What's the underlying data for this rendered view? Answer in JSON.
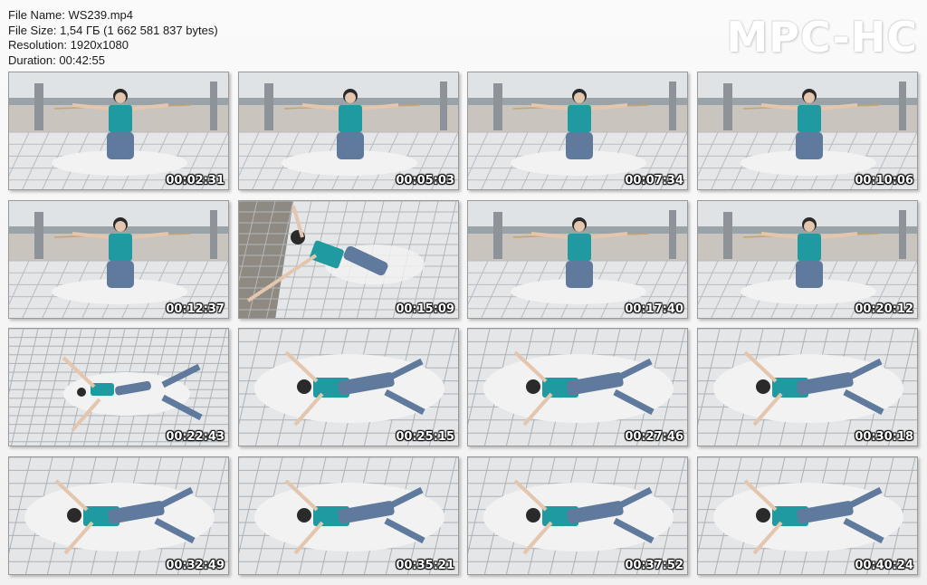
{
  "file_info": {
    "name_line": "File Name: WS239.mp4",
    "size_line": "File Size: 1,54 ГБ (1 662 581 837 bytes)",
    "resolution_line": "Resolution: 1920x1080",
    "duration_line": "Duration: 00:42:55"
  },
  "logo": "MPC-HC",
  "thumbnails": [
    {
      "time": "00:02:31",
      "scene": "kneel-roof"
    },
    {
      "time": "00:05:03",
      "scene": "kneel-roof"
    },
    {
      "time": "00:07:34",
      "scene": "kneel-roof"
    },
    {
      "time": "00:10:06",
      "scene": "kneel-roof"
    },
    {
      "time": "00:12:37",
      "scene": "kneel-roof"
    },
    {
      "time": "00:15:09",
      "scene": "tilted"
    },
    {
      "time": "00:17:40",
      "scene": "kneel-roof"
    },
    {
      "time": "00:20:12",
      "scene": "kneel-roof"
    },
    {
      "time": "00:22:43",
      "scene": "lying-far"
    },
    {
      "time": "00:25:15",
      "scene": "lying-mat"
    },
    {
      "time": "00:27:46",
      "scene": "lying-mat"
    },
    {
      "time": "00:30:18",
      "scene": "lying-mat"
    },
    {
      "time": "00:32:49",
      "scene": "lying-close"
    },
    {
      "time": "00:35:21",
      "scene": "lying-close"
    },
    {
      "time": "00:37:52",
      "scene": "lying-close"
    },
    {
      "time": "00:40:24",
      "scene": "lying-close"
    }
  ],
  "colors": {
    "shirt": "#1f9aa0",
    "jeans": "#5f7a9c",
    "floor": "#e4e6e8",
    "sky": "#dfe3e6",
    "mat": "#f2f2f2"
  }
}
